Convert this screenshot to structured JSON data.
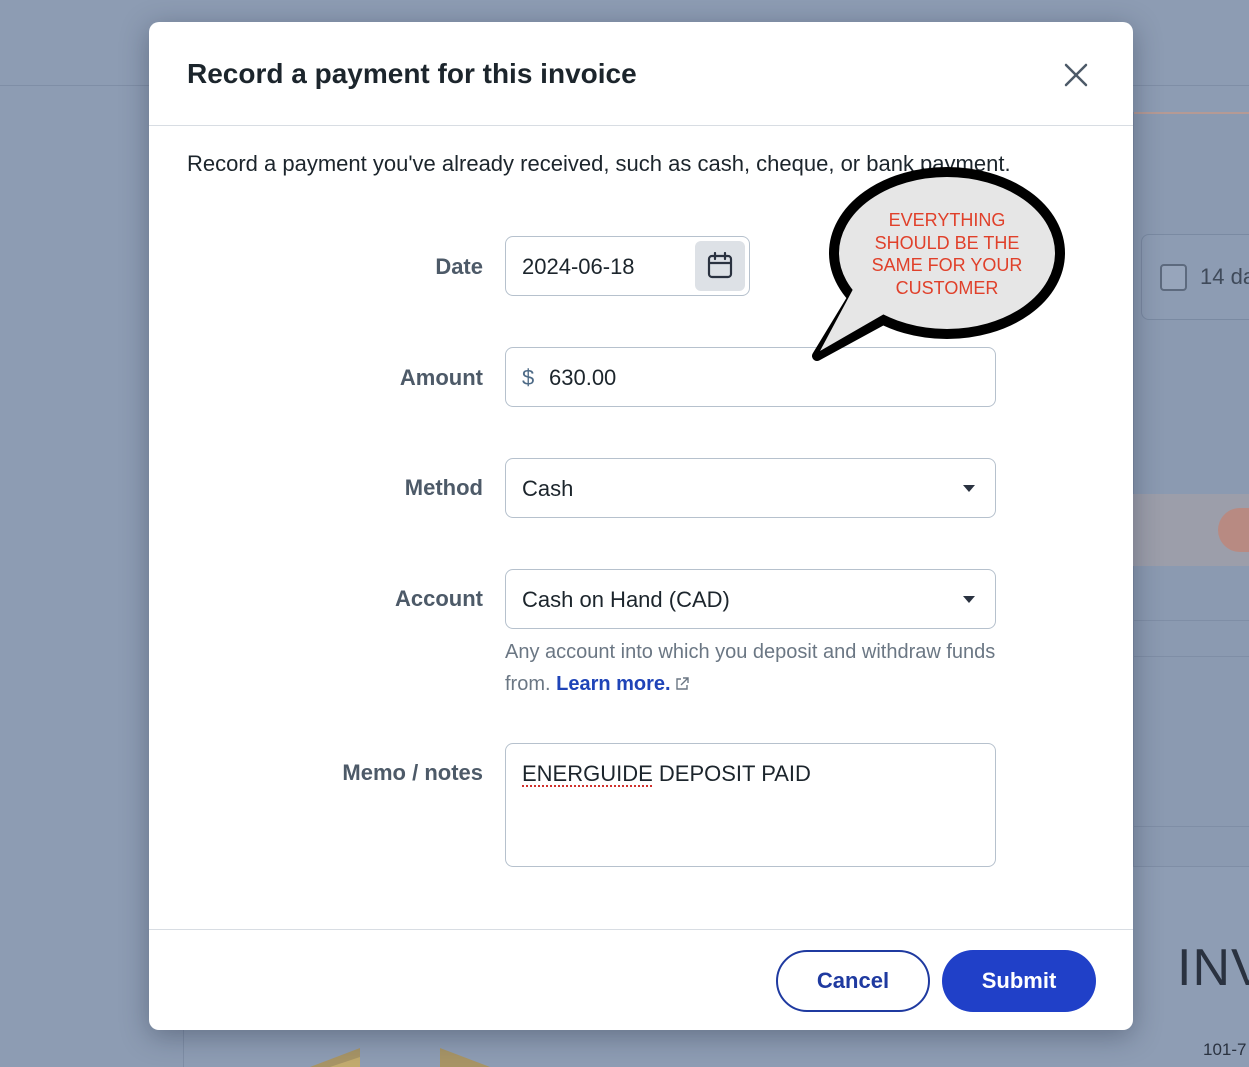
{
  "background": {
    "terms_checkbox_label": "14 da",
    "invoice_heading": "INV",
    "invoice_address": "101-7"
  },
  "modal": {
    "title": "Record a payment for this invoice",
    "intro": "Record a payment you've already received, such as cash, cheque, or bank payment.",
    "fields": {
      "date": {
        "label": "Date",
        "value": "2024-06-18"
      },
      "amount": {
        "label": "Amount",
        "currency_symbol": "$",
        "value": "630.00"
      },
      "method": {
        "label": "Method",
        "value": "Cash"
      },
      "account": {
        "label": "Account",
        "value": "Cash on Hand (CAD)",
        "help_text": "Any account into which you deposit and withdraw funds from.",
        "help_link": "Learn more."
      },
      "memo": {
        "label": "Memo / notes",
        "value_misspelled": "ENERGUIDE",
        "value_rest": " DEPOSIT PAID"
      }
    },
    "footer": {
      "cancel_label": "Cancel",
      "submit_label": "Submit"
    }
  },
  "annotation": {
    "lines": [
      "EVERYTHING",
      "SHOULD BE THE",
      "SAME FOR YOUR",
      "CUSTOMER"
    ],
    "text_color": "#e0402a"
  },
  "colors": {
    "primary": "#2040c8",
    "link": "#1f44b8",
    "overlay": "#8d9cb3"
  },
  "icons": [
    "close-icon",
    "calendar-icon",
    "chevron-down-icon",
    "external-link-icon"
  ]
}
